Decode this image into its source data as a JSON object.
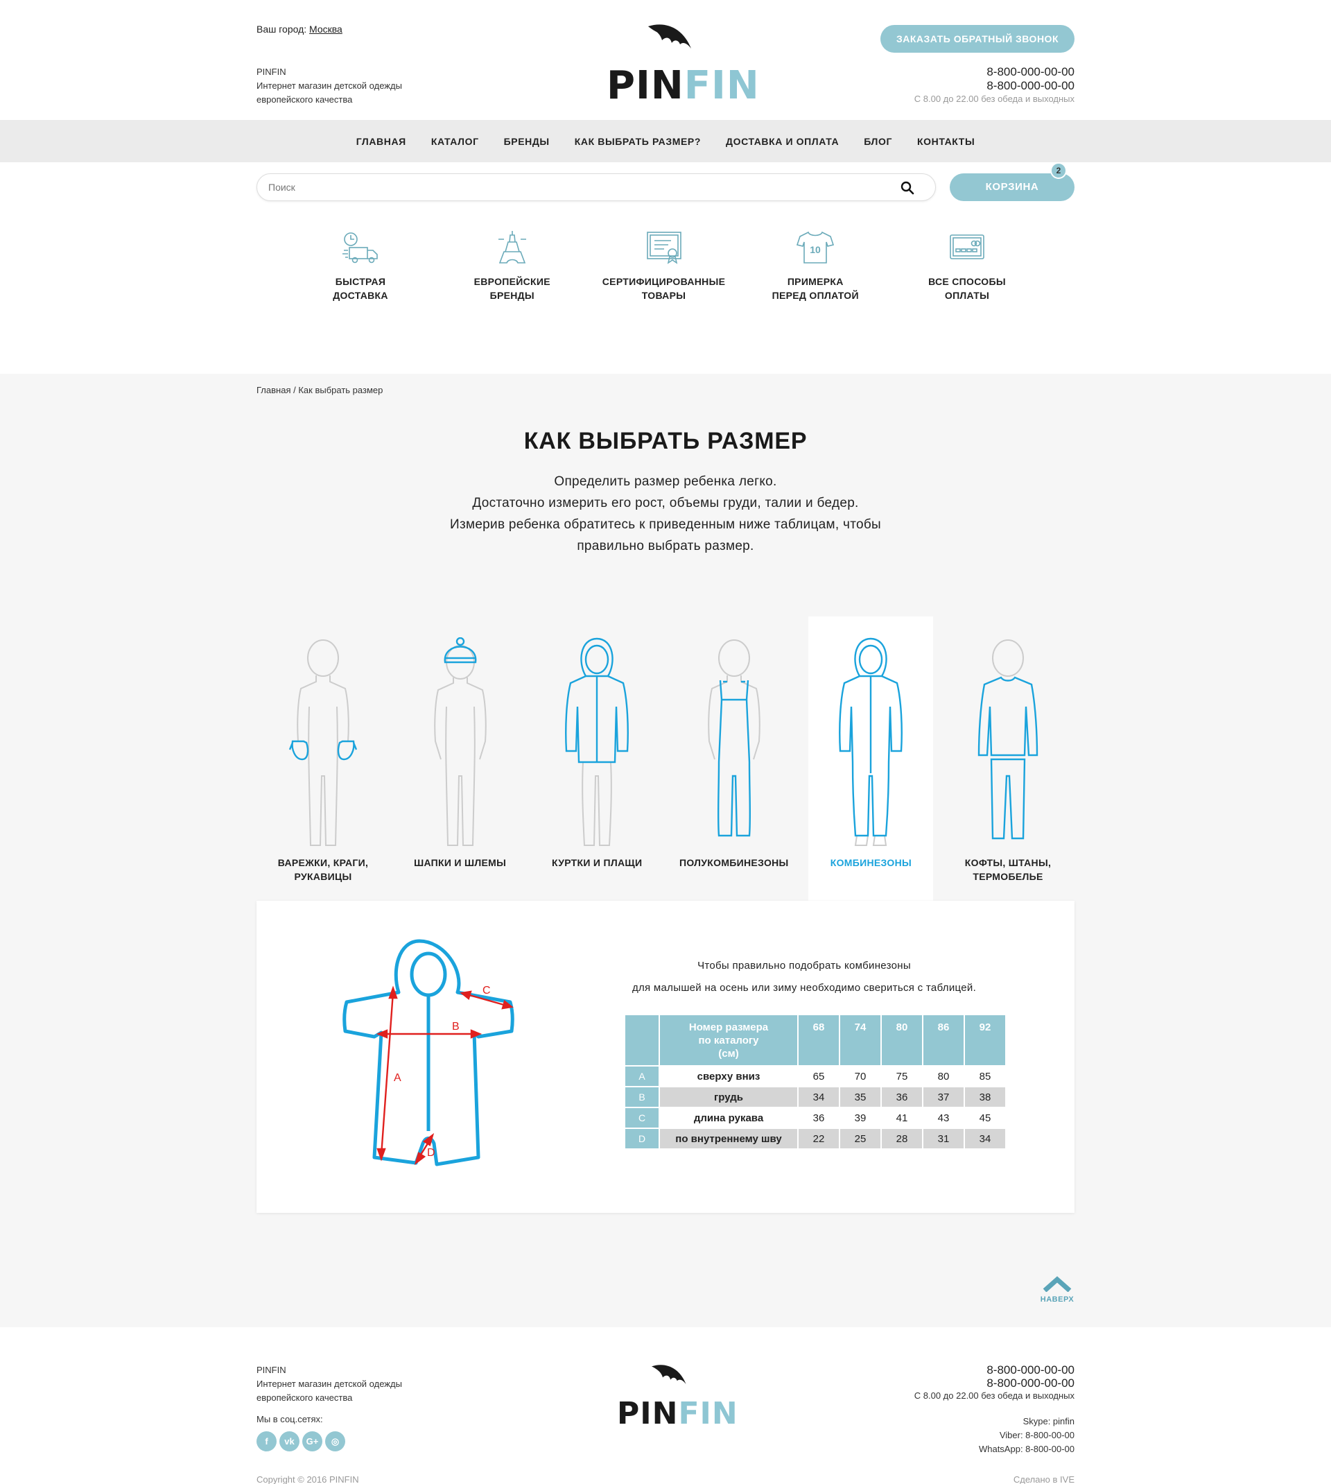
{
  "header": {
    "city_label": "Ваш город:",
    "city": "Москва",
    "brand_name": "PINFIN",
    "brand_tagline_1": "Интернет магазин детской одежды",
    "brand_tagline_2": "европейского качества",
    "logo_part1": "PIN",
    "logo_part2": "FIN",
    "callback_label": "ЗАКАЗАТЬ ОБРАТНЫЙ ЗВОНОК",
    "phone_1": "8-800-000-00-00",
    "phone_2": "8-800-000-00-00",
    "hours": "С 8.00 до 22.00 без обеда и выходных"
  },
  "nav": [
    "ГЛАВНАЯ",
    "КАТАЛОГ",
    "БРЕНДЫ",
    "КАК ВЫБРАТЬ РАЗМЕР?",
    "ДОСТАВКА И ОПЛАТА",
    "БЛОГ",
    "КОНТАКТЫ"
  ],
  "search": {
    "placeholder": "Поиск"
  },
  "cart": {
    "label": "КОРЗИНА",
    "count": "2"
  },
  "features": [
    {
      "line1": "БЫСТРАЯ",
      "line2": "ДОСТАВКА",
      "icon": "delivery-truck-icon"
    },
    {
      "line1": "ЕВРОПЕЙСКИЕ",
      "line2": "БРЕНДЫ",
      "icon": "eiffel-tower-icon"
    },
    {
      "line1": "СЕРТИФИЦИРОВАННЫЕ",
      "line2": "ТОВАРЫ",
      "icon": "certificate-icon"
    },
    {
      "line1": "ПРИМЕРКА",
      "line2": "ПЕРЕД ОПЛАТОЙ",
      "icon": "tshirt-icon"
    },
    {
      "line1": "ВСЕ СПОСОБЫ",
      "line2": "ОПЛАТЫ",
      "icon": "credit-card-icon"
    }
  ],
  "tshirt_number": "10",
  "breadcrumb": {
    "home": "Главная",
    "separator": "/",
    "current": "Как выбрать размер"
  },
  "page": {
    "title": "КАК ВЫБРАТЬ РАЗМЕР",
    "intro_1": "Определить размер ребенка легко.",
    "intro_2": "Достаточно измерить его рост, объемы груди, талии и бедер.",
    "intro_3": "Измерив ребенка обратитесь к приведенным ниже таблицам, чтобы",
    "intro_4": "правильно выбрать размер."
  },
  "categories": [
    {
      "line1": "ВАРЕЖКИ, КРАГИ,",
      "line2": "РУКАВИЦЫ"
    },
    {
      "line1": "ШАПКИ И ШЛЕМЫ",
      "line2": ""
    },
    {
      "line1": "КУРТКИ И ПЛАЩИ",
      "line2": ""
    },
    {
      "line1": "ПОЛУКОМБИНЕЗОНЫ",
      "line2": ""
    },
    {
      "line1": "КОМБИНЕЗОНЫ",
      "line2": ""
    },
    {
      "line1": "КОФТЫ, ШТАНЫ,",
      "line2": "ТЕРМОБЕЛЬЕ"
    }
  ],
  "active_category": "КОМБИНЕЗОНЫ",
  "panel": {
    "text_1": "Чтобы правильно подобрать комбинезоны",
    "text_2": "для малышей на осень или зиму необходимо свериться с таблицей.",
    "diagram_labels": {
      "a": "A",
      "b": "B",
      "c": "C",
      "d": "D"
    },
    "table": {
      "header_1": "Номер размера",
      "header_2": "по каталогу",
      "header_3": "(см)",
      "sizes": [
        "68",
        "74",
        "80",
        "86",
        "92"
      ],
      "rows": [
        {
          "letter": "A",
          "label": "сверху вниз",
          "values": [
            "65",
            "70",
            "75",
            "80",
            "85"
          ]
        },
        {
          "letter": "B",
          "label": "грудь",
          "values": [
            "34",
            "35",
            "36",
            "37",
            "38"
          ]
        },
        {
          "letter": "C",
          "label": "длина рукава",
          "values": [
            "36",
            "39",
            "41",
            "43",
            "45"
          ]
        },
        {
          "letter": "D",
          "label": "по внутреннему шву",
          "values": [
            "22",
            "25",
            "28",
            "31",
            "34"
          ]
        }
      ]
    }
  },
  "totop_label": "НАВЕРХ",
  "footer": {
    "brand_name": "PINFIN",
    "tagline_1": "Интернет магазин детской одежды",
    "tagline_2": "европейского качества",
    "social_label": "Мы в соц.сетях:",
    "social": [
      "f",
      "vk",
      "G+",
      "◎"
    ],
    "phone_1": "8-800-000-00-00",
    "phone_2": "8-800-000-00-00",
    "hours": "С 8.00 до 22.00 без обеда и выходных",
    "skype": "Skype: pinfin",
    "viber": "Viber: 8-800-00-00",
    "whatsapp": "WhatsApp: 8-800-00-00",
    "copyright": "Copyright © 2016 PINFIN",
    "made_by": "Сделано в IVE"
  },
  "colors": {
    "accent": "#93c7d2",
    "active": "#1aa3dc",
    "measure": "#e0201e"
  }
}
